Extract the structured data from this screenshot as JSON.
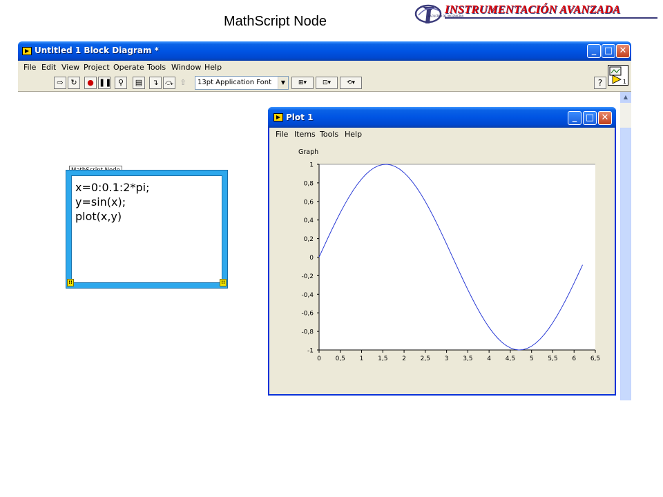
{
  "slide": {
    "title": "MathScript Node",
    "brand": "INSTRUMENTACIÓN AVANZADA",
    "brand_sub": "FACULTAD DE INGENIERIA"
  },
  "main_window": {
    "title": "Untitled 1 Block Diagram *",
    "menu": [
      "File",
      "Edit",
      "View",
      "Project",
      "Operate",
      "Tools",
      "Window",
      "Help"
    ],
    "font_select": "13pt Application Font",
    "connector_label": "1"
  },
  "mathscript": {
    "label": "MathScript Node",
    "code": "x=0:0.1:2*pi;\ny=sin(x);\nplot(x,y)"
  },
  "plot_window": {
    "title": "Plot 1",
    "menu": [
      "File",
      "Items",
      "Tools",
      "Help"
    ]
  },
  "chart_data": {
    "type": "line",
    "title": "Graph",
    "xlabel": "",
    "ylabel": "",
    "xlim": [
      0,
      6.5
    ],
    "ylim": [
      -1,
      1
    ],
    "x_ticks": [
      "0",
      "0,5",
      "1",
      "1,5",
      "2",
      "2,5",
      "3",
      "3,5",
      "4",
      "4,5",
      "5",
      "5,5",
      "6",
      "6,5"
    ],
    "y_ticks": [
      "1",
      "0,8",
      "0,6",
      "0,4",
      "0,2",
      "0",
      "-0,2",
      "-0,4",
      "-0,6",
      "-0,8",
      "-1"
    ],
    "series": [
      {
        "color": "#2a3bd6",
        "x": [
          0,
          0.1,
          0.2,
          0.3,
          0.4,
          0.5,
          0.6,
          0.7,
          0.8,
          0.9,
          1.0,
          1.1,
          1.2,
          1.3,
          1.4,
          1.5,
          1.6,
          1.7,
          1.8,
          1.9,
          2.0,
          2.1,
          2.2,
          2.3,
          2.4,
          2.5,
          2.6,
          2.7,
          2.8,
          2.9,
          3.0,
          3.1,
          3.2,
          3.3,
          3.4,
          3.5,
          3.6,
          3.7,
          3.8,
          3.9,
          4.0,
          4.1,
          4.2,
          4.3,
          4.4,
          4.5,
          4.6,
          4.7,
          4.8,
          4.9,
          5.0,
          5.1,
          5.2,
          5.3,
          5.4,
          5.5,
          5.6,
          5.7,
          5.8,
          5.9,
          6.0,
          6.1,
          6.2
        ],
        "y": [
          0,
          0.0998,
          0.1987,
          0.2955,
          0.3894,
          0.4794,
          0.5646,
          0.6442,
          0.7174,
          0.7833,
          0.8415,
          0.8912,
          0.932,
          0.9636,
          0.9854,
          0.9975,
          0.9996,
          0.9917,
          0.9738,
          0.9463,
          0.9093,
          0.8632,
          0.8085,
          0.7457,
          0.6755,
          0.5985,
          0.5155,
          0.4274,
          0.335,
          0.2392,
          0.1411,
          0.0416,
          -0.0584,
          -0.1577,
          -0.2555,
          -0.3508,
          -0.4425,
          -0.5298,
          -0.6119,
          -0.6878,
          -0.7568,
          -0.8183,
          -0.8716,
          -0.9162,
          -0.9516,
          -0.9775,
          -0.9937,
          -0.9999,
          -0.9962,
          -0.9825,
          -0.9589,
          -0.9258,
          -0.8835,
          -0.8323,
          -0.7728,
          -0.7055,
          -0.6313,
          -0.5507,
          -0.4646,
          -0.3739,
          -0.2794,
          -0.1822,
          -0.0831
        ]
      }
    ],
    "grid": false
  }
}
